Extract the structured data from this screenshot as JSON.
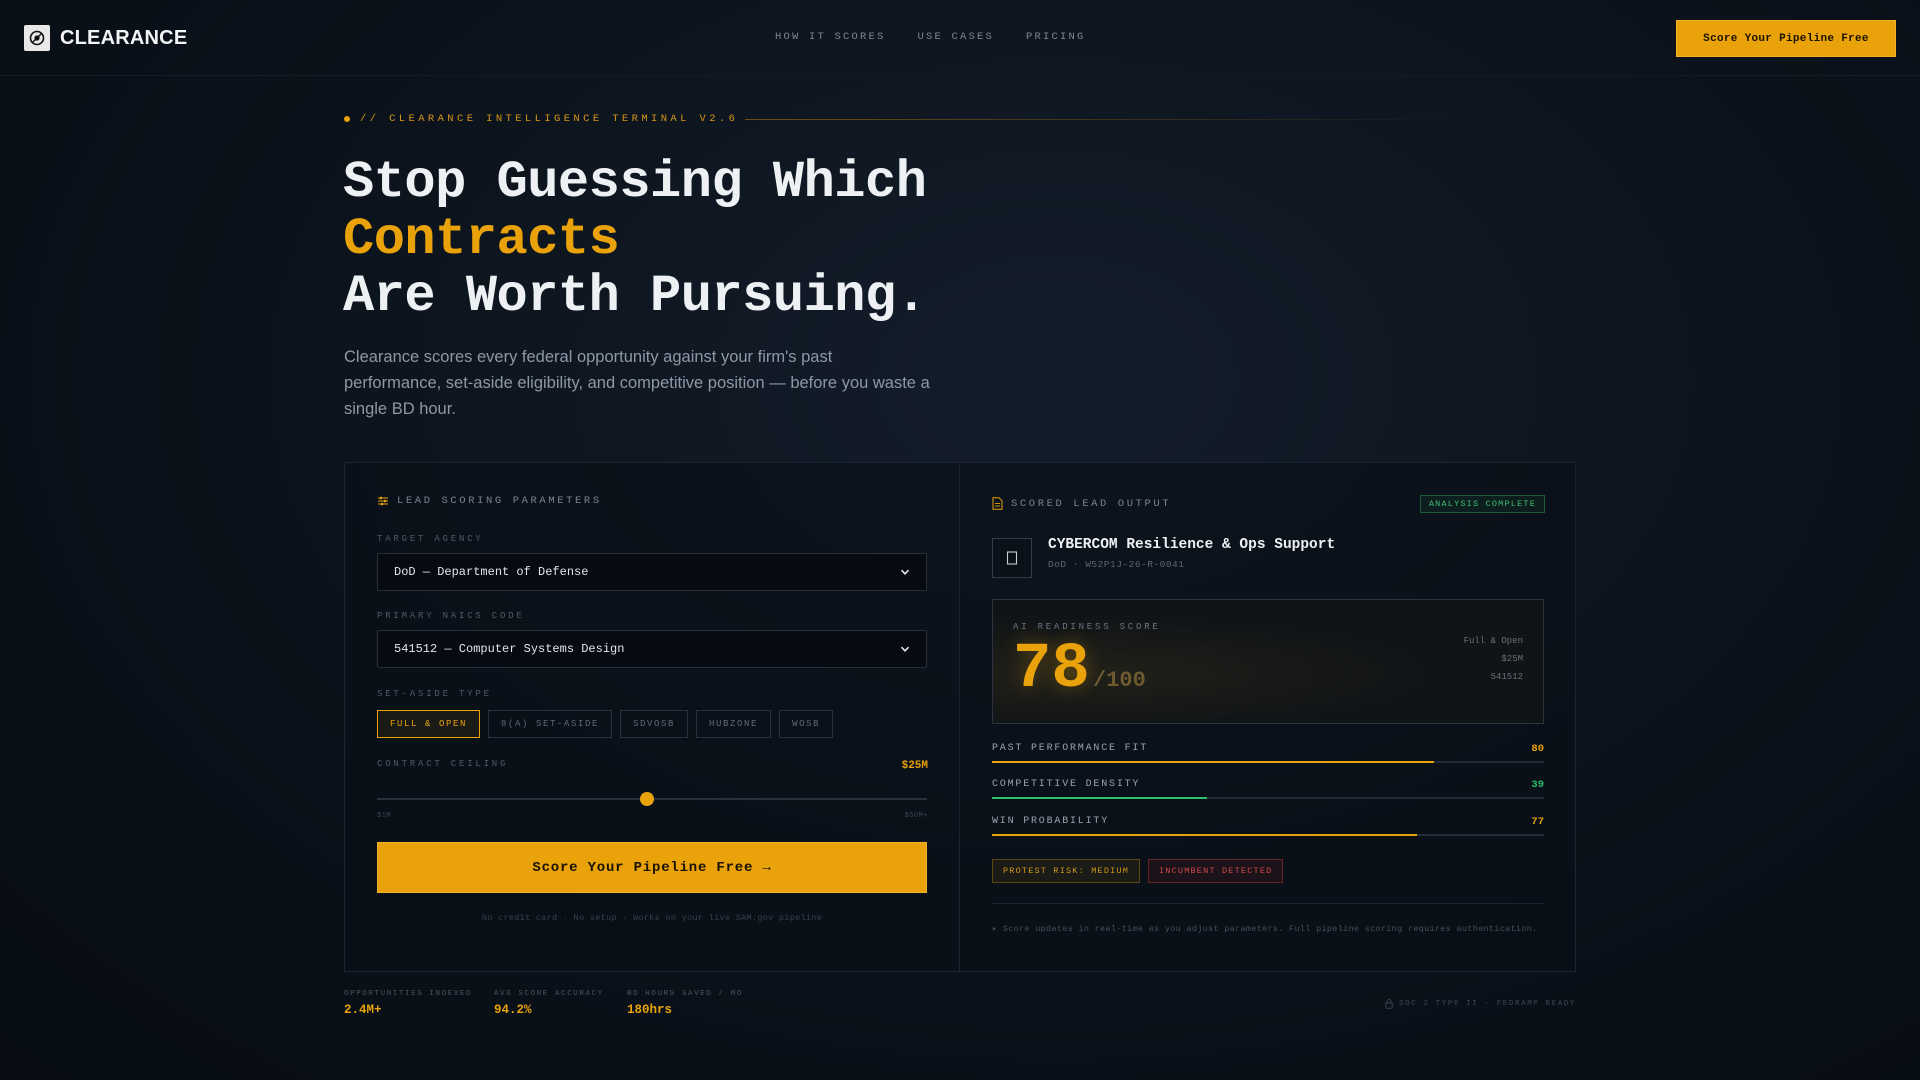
{
  "brand": {
    "name": "CLEARANCE"
  },
  "nav": {
    "links": [
      "HOW IT SCORES",
      "USE CASES",
      "PRICING"
    ],
    "cta": "Score Your Pipeline Free"
  },
  "hero": {
    "eyebrow": "// CLEARANCE INTELLIGENCE TERMINAL V2.6",
    "headline_line1": "Stop Guessing Which",
    "headline_accent": "Contracts",
    "headline_line3": "Are Worth Pursuing.",
    "subcopy": "Clearance scores every federal opportunity against your firm's past performance, set-aside eligibility, and competitive position — before you waste a single BD hour."
  },
  "params": {
    "title": "LEAD SCORING PARAMETERS",
    "agency_label": "TARGET AGENCY",
    "agency_value": "DoD — Department of Defense",
    "naics_label": "PRIMARY NAICS CODE",
    "naics_value": "541512 — Computer Systems Design",
    "setaside_label": "SET-ASIDE TYPE",
    "setaside_options": [
      "FULL & OPEN",
      "8(A) SET-ASIDE",
      "SDVOSB",
      "HUBZONE",
      "WOSB"
    ],
    "setaside_selected": "FULL & OPEN",
    "ceiling_label": "CONTRACT CEILING",
    "ceiling_value": "$25M",
    "ceiling_min": "$1M",
    "ceiling_max": "$50M+",
    "ceiling_fraction": 0.49,
    "button": "Score Your Pipeline Free →",
    "fineprint": "No credit card · No setup · Works on your live SAM.gov pipeline"
  },
  "output": {
    "title": "SCORED LEAD OUTPUT",
    "status": "ANALYSIS COMPLETE",
    "opportunity_title": "CYBERCOM Resilience & Ops Support",
    "opportunity_sub": "DoD · W52P1J-26-R-0041",
    "score_label": "AI READINESS SCORE",
    "score": "78",
    "score_denominator": "/100",
    "meta": [
      "Full & Open",
      "$25M",
      "541512"
    ],
    "metrics": [
      {
        "name": "PAST PERFORMANCE FIT",
        "value": 80,
        "color": "#e9a20a"
      },
      {
        "name": "COMPETITIVE DENSITY",
        "value": 39,
        "color": "#2fbf6a"
      },
      {
        "name": "WIN PROBABILITY",
        "value": 77,
        "color": "#e9a20a"
      }
    ],
    "tag_risk": "PROTEST RISK: MEDIUM",
    "tag_incumbent": "INCUMBENT DETECTED",
    "note": "▸ Score updates in real-time as you adjust parameters. Full pipeline scoring requires authentication."
  },
  "stats": [
    {
      "label": "OPPORTUNITIES INDEXED",
      "value": "2.4M+"
    },
    {
      "label": "AVG SCORE ACCURACY",
      "value": "94.2%"
    },
    {
      "label": "BD HOURS SAVED / MO",
      "value": "180hrs"
    }
  ],
  "compliance": "SOC 2 TYPE II · FEDRAMP READY",
  "colors": {
    "accent": "#e9a20a",
    "success": "#2fbf6a",
    "danger": "#d24a4a",
    "background": "#0b121b"
  }
}
